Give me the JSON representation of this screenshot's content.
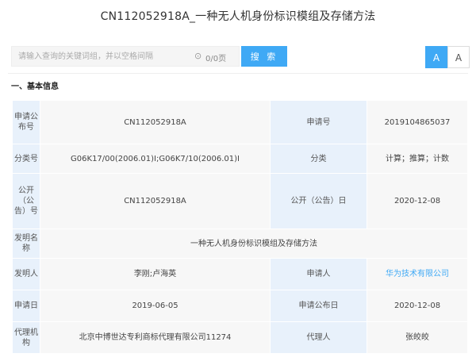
{
  "page": {
    "title": "CN112052918A_一种无人机身份标识模组及存储方法"
  },
  "search": {
    "placeholder": "请输入查询的关键词组，并以空格间隔",
    "clear_symbol": "⊙",
    "count": "0/0页",
    "button_label": "搜 索"
  },
  "font_size_toggle": {
    "large": "A",
    "small": "A"
  },
  "section": {
    "heading": "一、基本信息"
  },
  "info": {
    "pub_number_label": "申请公布号",
    "pub_number": "CN112052918A",
    "app_number_label": "申请号",
    "app_number": "2019104865037",
    "class_number_label": "分类号",
    "class_number": "G06K17/00(2006.01)I;G06K7/10(2006.01)I",
    "category_label": "分类",
    "category": "计算；推算；计数",
    "grant_number_label": "公开（公告）号",
    "grant_number": "CN112052918A",
    "grant_date_label": "公开（公告）日",
    "grant_date": "2020-12-08",
    "invention_name_label": "发明名称",
    "invention_name": "一种无人机身份标识模组及存储方法",
    "inventor_label": "发明人",
    "inventor": "李刚;卢海英",
    "applicant_label": "申请人",
    "applicant": "华为技术有限公司",
    "app_date_label": "申请日",
    "app_date": "2019-06-05",
    "app_pub_date_label": "申请公布日",
    "app_pub_date": "2020-12-08",
    "agency_label": "代理机构",
    "agency": "北京中博世达专利商标代理有限公司11274",
    "agent_label": "代理人",
    "agent": "张皎皎"
  },
  "colors": {
    "accent": "#3fa9f5",
    "label_bg": "#e8f1fb",
    "value_bg": "#f7f7f7",
    "link": "#3fa9f5"
  }
}
